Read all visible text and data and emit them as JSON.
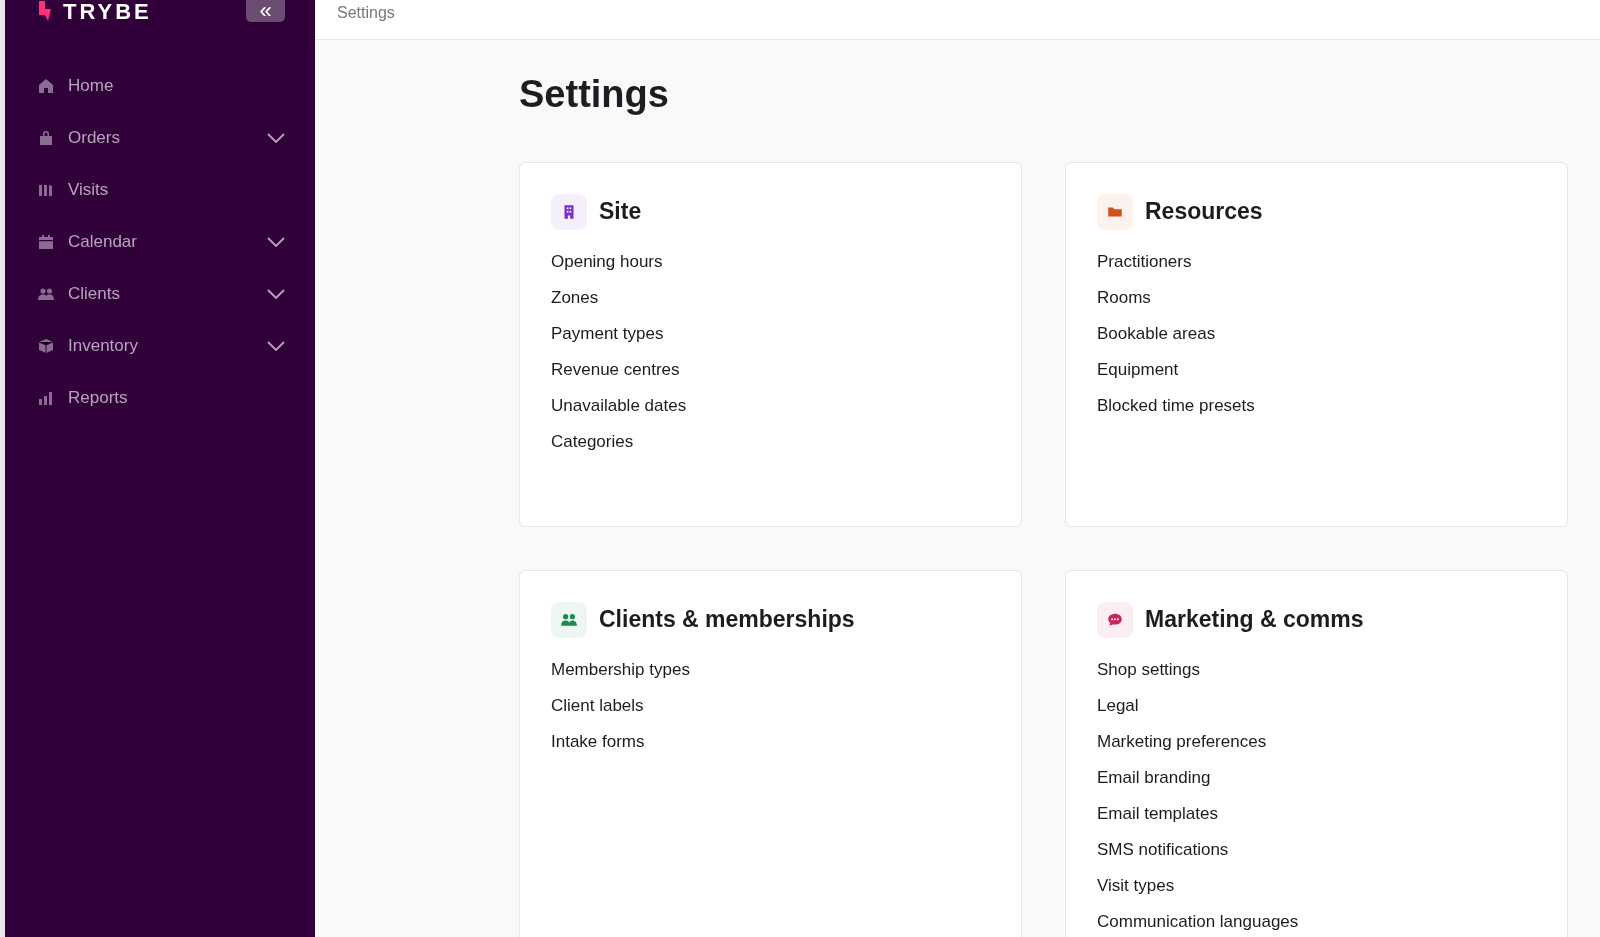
{
  "sidebar": {
    "logo": "TRYBE",
    "collapse_button": "«",
    "items": [
      {
        "label": "Home",
        "kind": "link",
        "expanded": false
      },
      {
        "label": "Orders",
        "kind": "group",
        "expanded": false
      },
      {
        "label": "Visits",
        "kind": "link",
        "expanded": false
      },
      {
        "label": "Calendar",
        "kind": "group",
        "expanded": false
      },
      {
        "label": "Clients",
        "kind": "group",
        "expanded": false
      },
      {
        "label": "Inventory",
        "kind": "group",
        "expanded": false
      },
      {
        "label": "Reports",
        "kind": "link",
        "expanded": false
      }
    ]
  },
  "topbar": {
    "breadcrumb": "Settings"
  },
  "page": {
    "title": "Settings"
  },
  "cards": [
    {
      "title": "Site",
      "color": "#7b2fc9",
      "links": [
        "Opening hours",
        "Zones",
        "Payment types",
        "Revenue centres",
        "Unavailable dates",
        "Categories"
      ]
    },
    {
      "title": "Resources",
      "color": "#d2501c",
      "links": [
        "Practitioners",
        "Rooms",
        "Bookable areas",
        "Equipment",
        "Blocked time presets"
      ]
    },
    {
      "title": "Clients & memberships",
      "color": "#1f8a4c",
      "links": [
        "Membership types",
        "Client labels",
        "Intake forms"
      ]
    },
    {
      "title": "Marketing & comms",
      "color": "#c8245f",
      "links": [
        "Shop settings",
        "Legal",
        "Marketing preferences",
        "Email branding",
        "Email templates",
        "SMS notifications",
        "Visit types",
        "Communication languages"
      ]
    }
  ]
}
